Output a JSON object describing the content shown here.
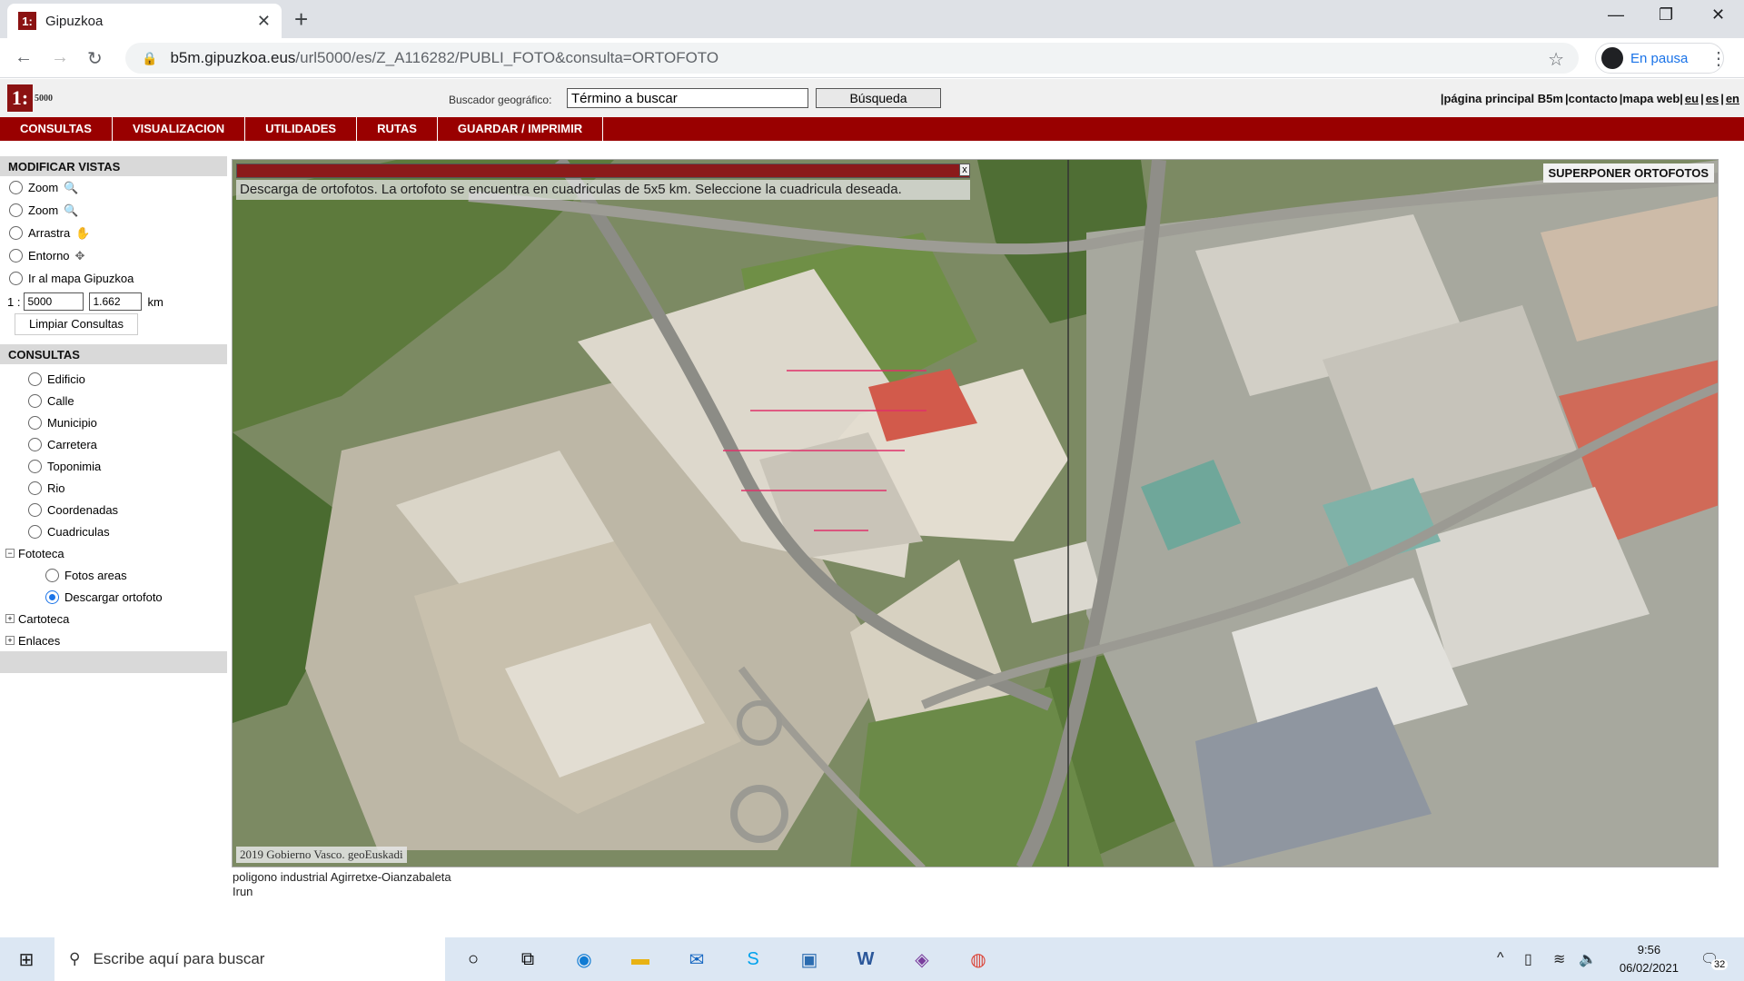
{
  "browser": {
    "tab_title": "Gipuzkoa",
    "favicon_text": "1:",
    "url_host": "b5m.gipuzkoa.eus",
    "url_path": "/url5000/es/Z_A116282/PUBLI_FOTO&consulta=ORTOFOTO",
    "profile_label": "En pausa"
  },
  "header": {
    "logo_text": "1:",
    "logo_scale": "5000",
    "search_label": "Buscador geográfico:",
    "search_value": "Término a buscar",
    "search_button": "Búsqueda",
    "links": [
      {
        "label": "|página principal B5m",
        "underline": false
      },
      {
        "label": "|contacto",
        "underline": false
      },
      {
        "label": "|mapa web|",
        "underline": false
      },
      {
        "label": "eu",
        "underline": true
      },
      {
        "label": "|",
        "underline": false
      },
      {
        "label": "es",
        "underline": true
      },
      {
        "label": "|",
        "underline": false
      },
      {
        "label": "en",
        "underline": true
      }
    ]
  },
  "nav": [
    "CONSULTAS",
    "VISUALIZACION",
    "UTILIDADES",
    "RUTAS",
    "GUARDAR / IMPRIMIR"
  ],
  "views": {
    "title": "MODIFICAR VISTAS",
    "options": [
      {
        "label": "Zoom",
        "icon": "zoom-in-icon",
        "glyph": "🔍"
      },
      {
        "label": "Zoom",
        "icon": "zoom-out-icon",
        "glyph": "🔍"
      },
      {
        "label": "Arrastra",
        "icon": "hand-icon",
        "glyph": "✋"
      },
      {
        "label": "Entorno",
        "icon": "move-icon",
        "glyph": "✥"
      },
      {
        "label": "Ir al mapa Gipuzkoa",
        "icon": "",
        "glyph": ""
      }
    ],
    "scale_prefix": "1 :",
    "scale_value": "5000",
    "distance_value": "1.662",
    "distance_unit": "km",
    "clear_button": "Limpiar Consultas"
  },
  "queries": {
    "title": "CONSULTAS",
    "items": [
      "Edificio",
      "Calle",
      "Municipio",
      "Carretera",
      "Toponimia",
      "Rio",
      "Coordenadas",
      "Cuadriculas"
    ],
    "fototeca": {
      "label": "Fototeca",
      "children": [
        {
          "label": "Fotos areas",
          "selected": false
        },
        {
          "label": "Descargar ortofoto",
          "selected": true
        }
      ]
    },
    "cartoteca": "Cartoteca",
    "enlaces": "Enlaces"
  },
  "map": {
    "message": "Descarga de ortofotos. La ortofoto se encuentra en cuadriculas de 5x5 km. Seleccione la cuadricula deseada.",
    "close_label": "x",
    "overlay_button": "SUPERPONER ORTOFOTOS",
    "copyright": "2019 Gobierno Vasco. geoEuskadi"
  },
  "caption": {
    "line1": "poligono industrial Agirretxe-Oianzabaleta",
    "line2": "Irun"
  },
  "taskbar": {
    "search_placeholder": "Escribe aquí para buscar",
    "time": "9:56",
    "date": "06/02/2021",
    "notifications": "32"
  }
}
